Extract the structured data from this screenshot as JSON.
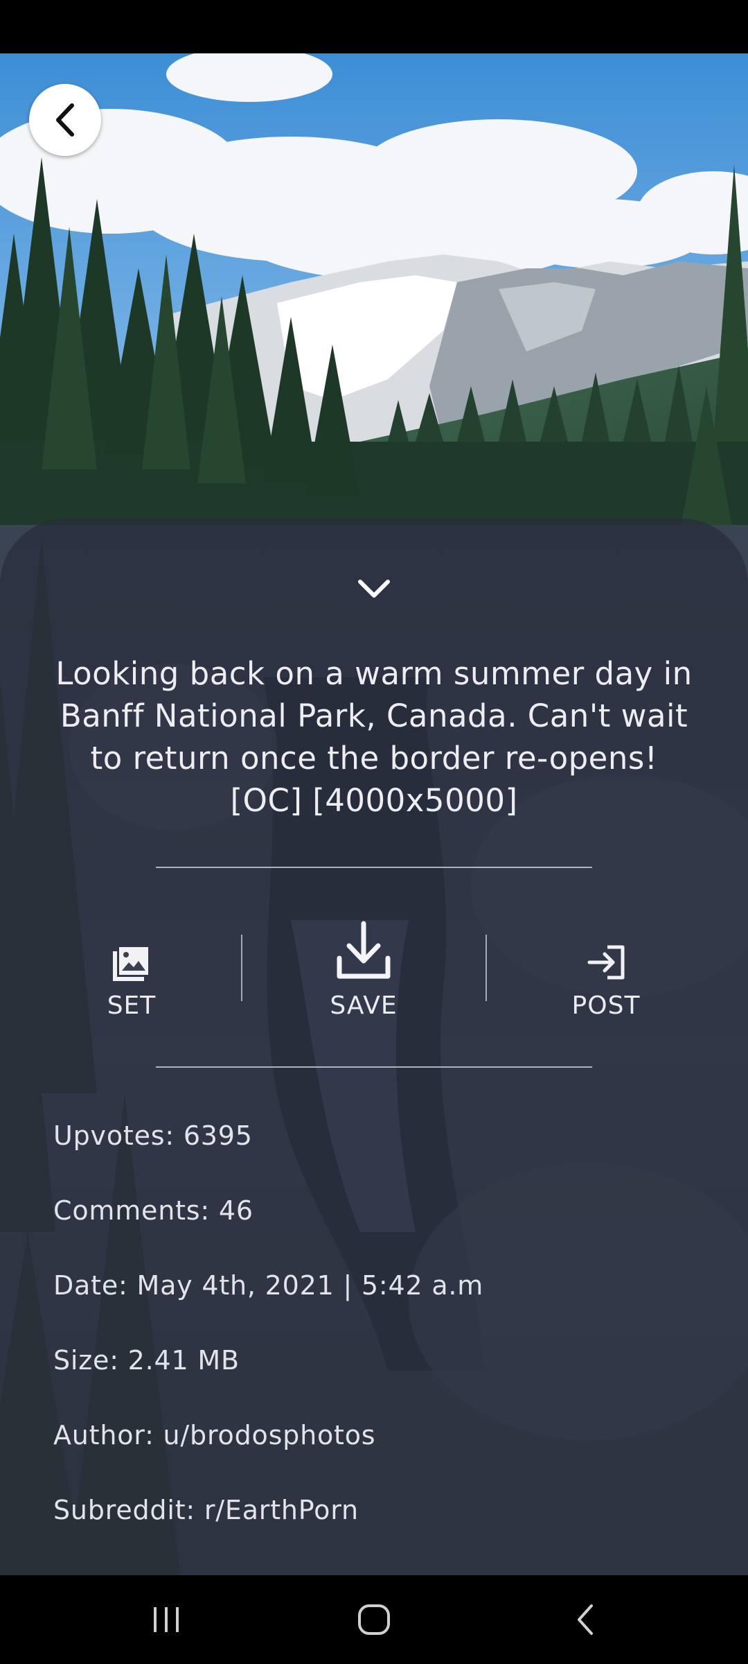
{
  "post": {
    "title": "Looking back on a warm summer day in Banff National Park, Canada. Can't wait to return once the border re-opens! [OC] [4000x5000]"
  },
  "actions": {
    "set_label": "SET",
    "save_label": "SAVE",
    "post_label": "POST"
  },
  "details": {
    "upvotes": "Upvotes: 6395",
    "comments": "Comments: 46",
    "date": "Date: May 4th, 2021 | 5:42 a.m",
    "size": "Size: 2.41 MB",
    "author": "Author: u/brodosphotos",
    "subreddit": "Subreddit: r/EarthPorn"
  },
  "icons": {
    "back": "chevron-left-icon",
    "collapse": "chevron-down-icon",
    "set": "image-icon",
    "save": "download-icon",
    "post": "login-icon",
    "nav_recents": "recents-icon",
    "nav_home": "home-icon",
    "nav_back": "back-icon"
  },
  "colors": {
    "sheet": "#282c3c",
    "text": "#eeeef2"
  }
}
